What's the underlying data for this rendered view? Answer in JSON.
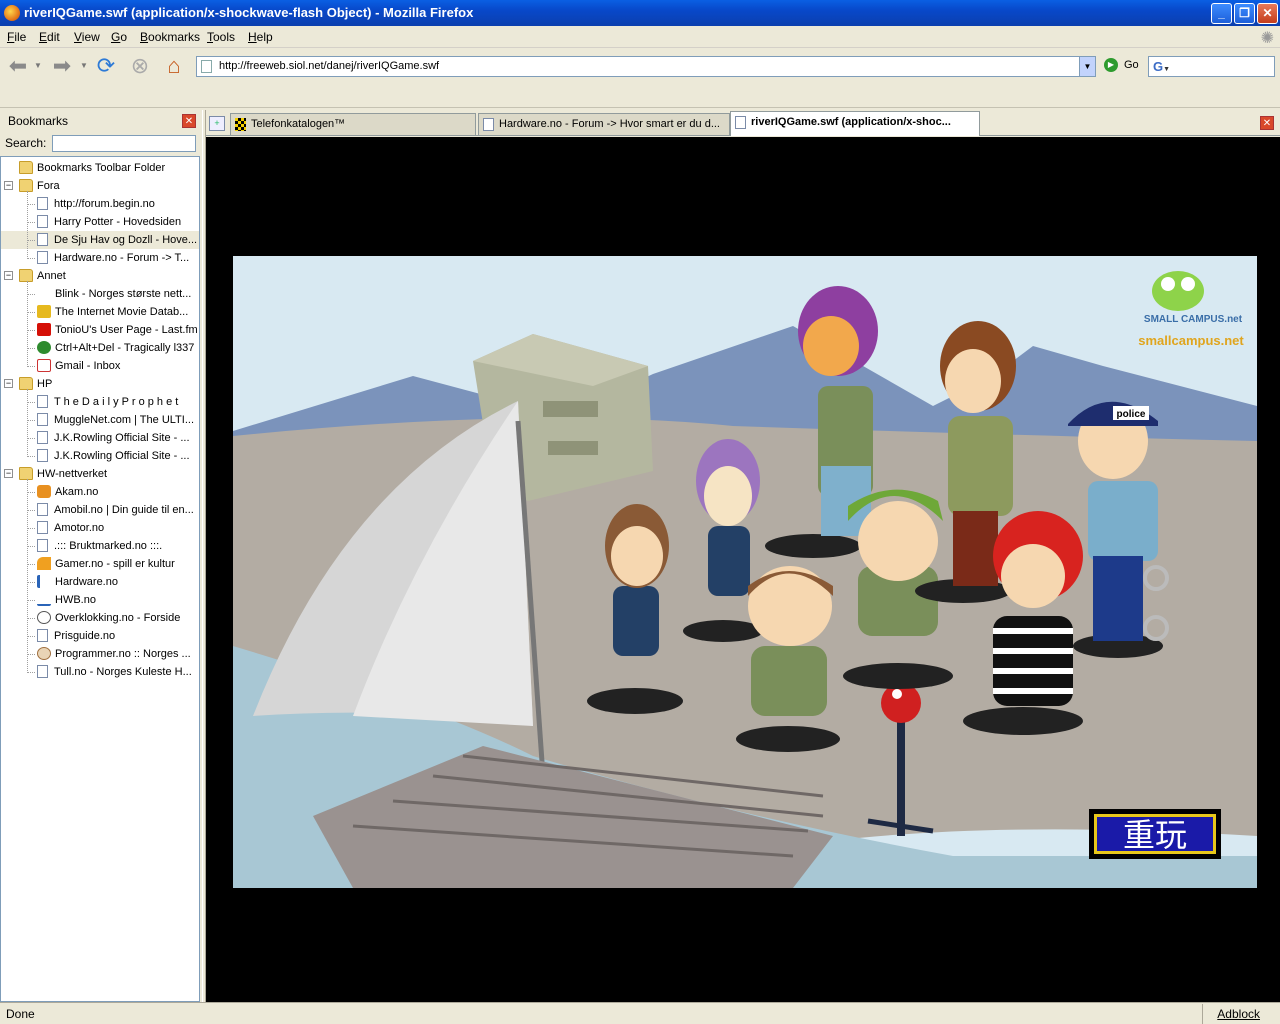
{
  "window": {
    "title": "riverIQGame.swf (application/x-shockwave-flash Object) - Mozilla Firefox"
  },
  "menu": [
    "File",
    "Edit",
    "View",
    "Go",
    "Bookmarks",
    "Tools",
    "Help"
  ],
  "toolbar": {
    "url": "http://freeweb.siol.net/danej/riverIQGame.swf",
    "go_label": "Go",
    "search_logo": "G"
  },
  "sidebar": {
    "title": "Bookmarks",
    "search_label": "Search:",
    "items": [
      {
        "label": "Bookmarks Toolbar Folder",
        "type": "folder",
        "depth": 0
      },
      {
        "label": "Fora",
        "type": "folder-open",
        "depth": 0
      },
      {
        "label": "http://forum.begin.no",
        "type": "page",
        "depth": 1
      },
      {
        "label": "Harry Potter - Hovedsiden",
        "type": "page",
        "depth": 1
      },
      {
        "label": "De Sju Hav og Dozll - Hove...",
        "type": "page",
        "depth": 1,
        "selected": true
      },
      {
        "label": "Hardware.no - Forum -> T...",
        "type": "page",
        "depth": 1
      },
      {
        "label": "Annet",
        "type": "folder-open",
        "depth": 0
      },
      {
        "label": "Blink - Norges største nett...",
        "type": "blink",
        "depth": 1
      },
      {
        "label": "The Internet Movie Datab...",
        "type": "imdb",
        "depth": 1
      },
      {
        "label": "TonioU's User Page - Last.fm",
        "type": "lastfm",
        "depth": 1
      },
      {
        "label": "Ctrl+Alt+Del - Tragically l337",
        "type": "cad",
        "depth": 1
      },
      {
        "label": "Gmail - Inbox",
        "type": "gmail",
        "depth": 1
      },
      {
        "label": "HP",
        "type": "folder-open",
        "depth": 0
      },
      {
        "label": "T h e D a i l y P r o p h e t",
        "type": "page",
        "depth": 1
      },
      {
        "label": "MuggleNet.com | The ULTI...",
        "type": "page",
        "depth": 1
      },
      {
        "label": "J.K.Rowling Official Site - ...",
        "type": "page",
        "depth": 1
      },
      {
        "label": "J.K.Rowling Official Site - ...",
        "type": "page",
        "depth": 1
      },
      {
        "label": "HW-nettverket",
        "type": "folder-open",
        "depth": 0
      },
      {
        "label": "Akam.no",
        "type": "akam",
        "depth": 1
      },
      {
        "label": "Amobil.no | Din guide til en...",
        "type": "page",
        "depth": 1
      },
      {
        "label": "Amotor.no",
        "type": "page",
        "depth": 1
      },
      {
        "label": ".::: Bruktmarked.no :::.",
        "type": "page",
        "depth": 1
      },
      {
        "label": "Gamer.no - spill er kultur",
        "type": "gamer",
        "depth": 1
      },
      {
        "label": "Hardware.no",
        "type": "hw",
        "depth": 1
      },
      {
        "label": "HWB.no",
        "type": "hwb",
        "depth": 1
      },
      {
        "label": "Overklokking.no - Forside",
        "type": "ok",
        "depth": 1
      },
      {
        "label": "Prisguide.no",
        "type": "page",
        "depth": 1
      },
      {
        "label": "Programmer.no :: Norges ...",
        "type": "prog",
        "depth": 1
      },
      {
        "label": "Tull.no - Norges Kuleste H...",
        "type": "page",
        "depth": 1
      }
    ]
  },
  "tabs": [
    {
      "label": "Telefonkatalogen™",
      "active": false
    },
    {
      "label": "Hardware.no - Forum -> Hvor smart er du d...",
      "active": false
    },
    {
      "label": "riverIQGame.swf (application/x-shoc...",
      "active": true
    }
  ],
  "flash": {
    "logo_text": "smallcampus.net",
    "logo_word": "SMALL CAMPUS.net",
    "police_cap": "police",
    "replay_button": "重玩"
  },
  "status": {
    "text": "Done",
    "adblock": "Adblock"
  },
  "colors": {
    "titlebar": "#0848c9",
    "chrome": "#ece9d8",
    "replay_bg": "#1a1aa8",
    "replay_border": "#e8c81a"
  }
}
